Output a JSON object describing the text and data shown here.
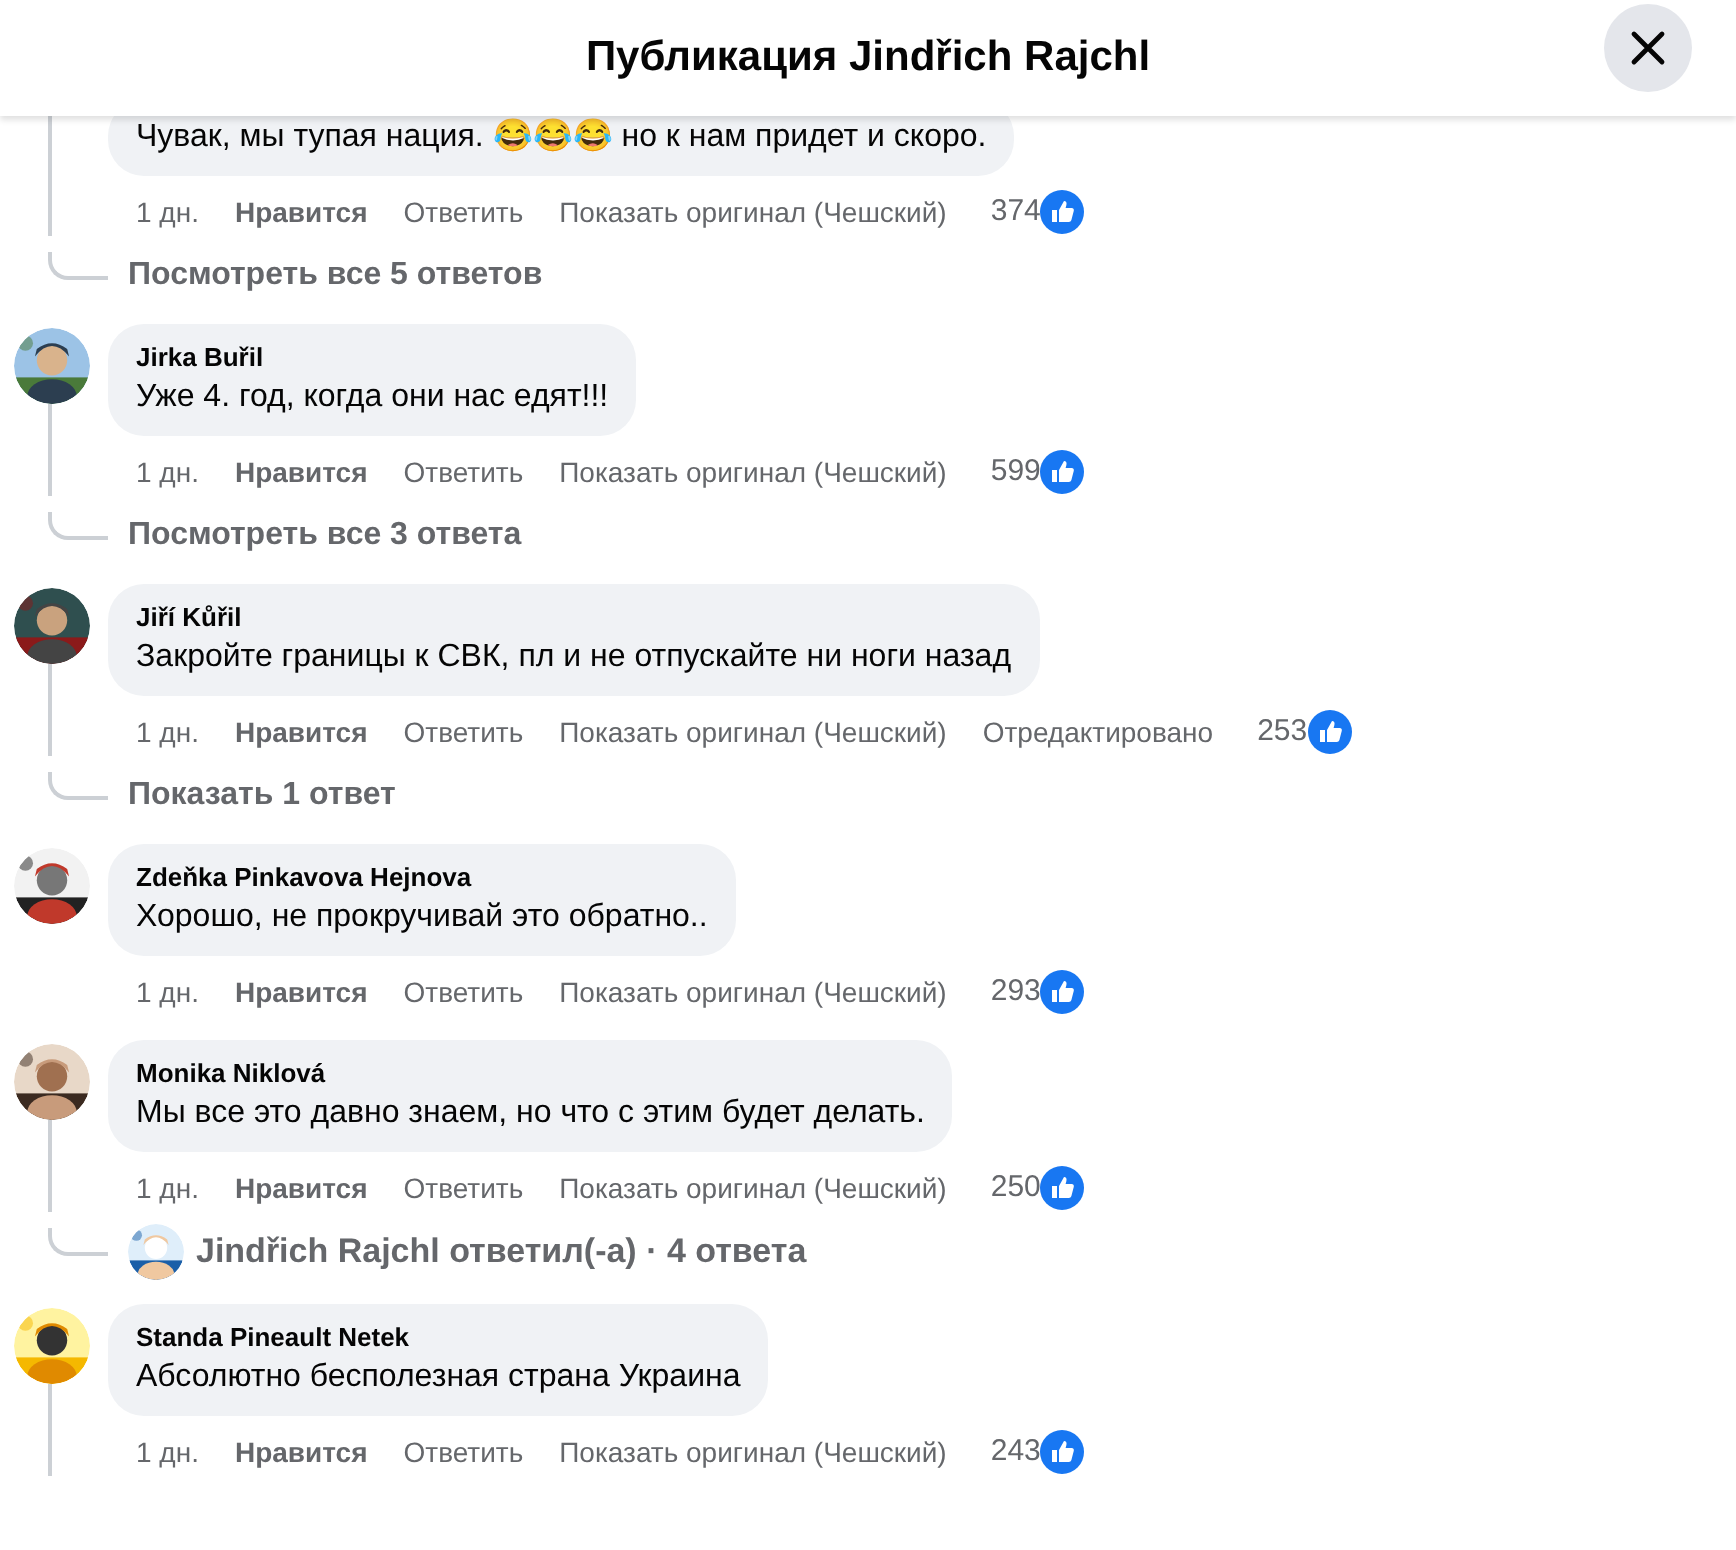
{
  "header": {
    "title": "Публикация Jindřich Rajchl"
  },
  "comments": [
    {
      "text": "Чувак, мы тупая нация. 😂😂😂 но к нам придет и скоро.",
      "thread": true,
      "actions": [
        {
          "kind": "time",
          "label": "1 дн."
        },
        {
          "kind": "like",
          "label": "Нравится"
        },
        {
          "kind": "reply",
          "label": "Ответить"
        },
        {
          "kind": "translate",
          "label": "Показать оригинал (Чешский)"
        }
      ],
      "likes": "374",
      "replies": {
        "kind": "view",
        "label": "Посмотреть все 5 ответов"
      }
    },
    {
      "author": "Jirka Buřil",
      "text": "Уже 4. год, когда они нас едят!!!",
      "thread": true,
      "actions": [
        {
          "kind": "time",
          "label": "1 дн."
        },
        {
          "kind": "like",
          "label": "Нравится"
        },
        {
          "kind": "reply",
          "label": "Ответить"
        },
        {
          "kind": "translate",
          "label": "Показать оригинал (Чешский)"
        }
      ],
      "likes": "599",
      "replies": {
        "kind": "view",
        "label": "Посмотреть все 3 ответа"
      }
    },
    {
      "author": "Jiří Kůřil",
      "text": "Закройте границы к СВК, пл и не отпускайте ни ноги назад",
      "thread": true,
      "actions": [
        {
          "kind": "time",
          "label": "1 дн."
        },
        {
          "kind": "like",
          "label": "Нравится"
        },
        {
          "kind": "reply",
          "label": "Ответить"
        },
        {
          "kind": "translate",
          "label": "Показать оригинал (Чешский)"
        },
        {
          "kind": "edited",
          "label": "Отредактировано"
        }
      ],
      "likes": "253",
      "replies": {
        "kind": "view",
        "label": "Показать 1 ответ"
      }
    },
    {
      "author": "Zdeňka Pinkavova Hejnova",
      "text": "Хорошо, не прокручивай это обратно..",
      "thread": false,
      "actions": [
        {
          "kind": "time",
          "label": "1 дн."
        },
        {
          "kind": "like",
          "label": "Нравится"
        },
        {
          "kind": "reply",
          "label": "Ответить"
        },
        {
          "kind": "translate",
          "label": "Показать оригинал (Чешский)"
        }
      ],
      "likes": "293"
    },
    {
      "author": "Monika Niklová",
      "text": "Мы все это давно знаем, но что с этим будет делать.",
      "thread": true,
      "actions": [
        {
          "kind": "time",
          "label": "1 дн."
        },
        {
          "kind": "like",
          "label": "Нравится"
        },
        {
          "kind": "reply",
          "label": "Ответить"
        },
        {
          "kind": "translate",
          "label": "Показать оригинал (Чешский)"
        }
      ],
      "likes": "250",
      "replies": {
        "kind": "replied",
        "label": "Jindřich Rajchl ответил(-а) · 4 ответа"
      }
    },
    {
      "author": "Standa Pineault Netek",
      "text": "Абсолютно бесполезная страна Украина",
      "thread": true,
      "actions": [
        {
          "kind": "time",
          "label": "1 дн."
        },
        {
          "kind": "like",
          "label": "Нравится"
        },
        {
          "kind": "reply",
          "label": "Ответить"
        },
        {
          "kind": "translate",
          "label": "Показать оригинал (Чешский)"
        }
      ],
      "likes": "243"
    }
  ]
}
